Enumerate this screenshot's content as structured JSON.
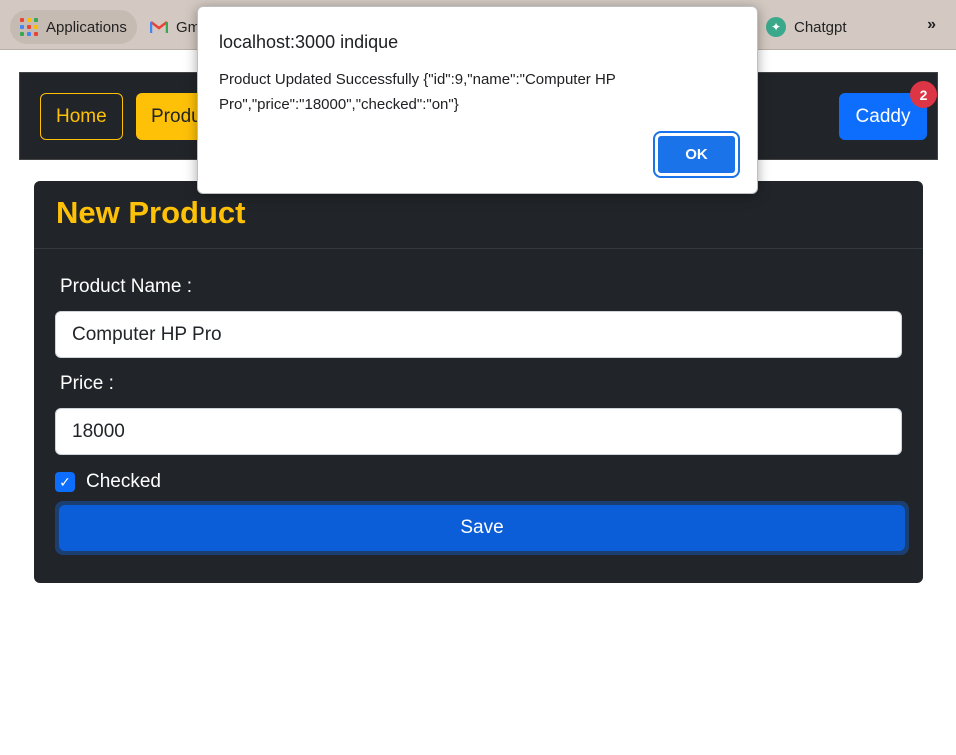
{
  "bookmarks": {
    "apps_label": "Applications",
    "gmail_label": "Gm",
    "chatgpt_label": "Chatgpt",
    "more": "»"
  },
  "navbar": {
    "home": "Home",
    "products": "Produ",
    "caddy": "Caddy",
    "caddy_count": "2"
  },
  "form": {
    "title": "New Product",
    "name_label": "Product Name :",
    "name_value": "Computer HP Pro",
    "price_label": "Price :",
    "price_value": "18000",
    "checked_label": "Checked",
    "checked": true,
    "save_label": "Save"
  },
  "dialog": {
    "title": "localhost:3000 indique",
    "message": "Product Updated Successfully {\"id\":9,\"name\":\"Computer HP Pro\",\"price\":\"18000\",\"checked\":\"on\"}",
    "ok_label": "OK"
  },
  "colors": {
    "accent_yellow": "#ffc107",
    "primary_blue": "#0d6efd",
    "dark_bg": "#212529",
    "badge_red": "#dc3545"
  }
}
